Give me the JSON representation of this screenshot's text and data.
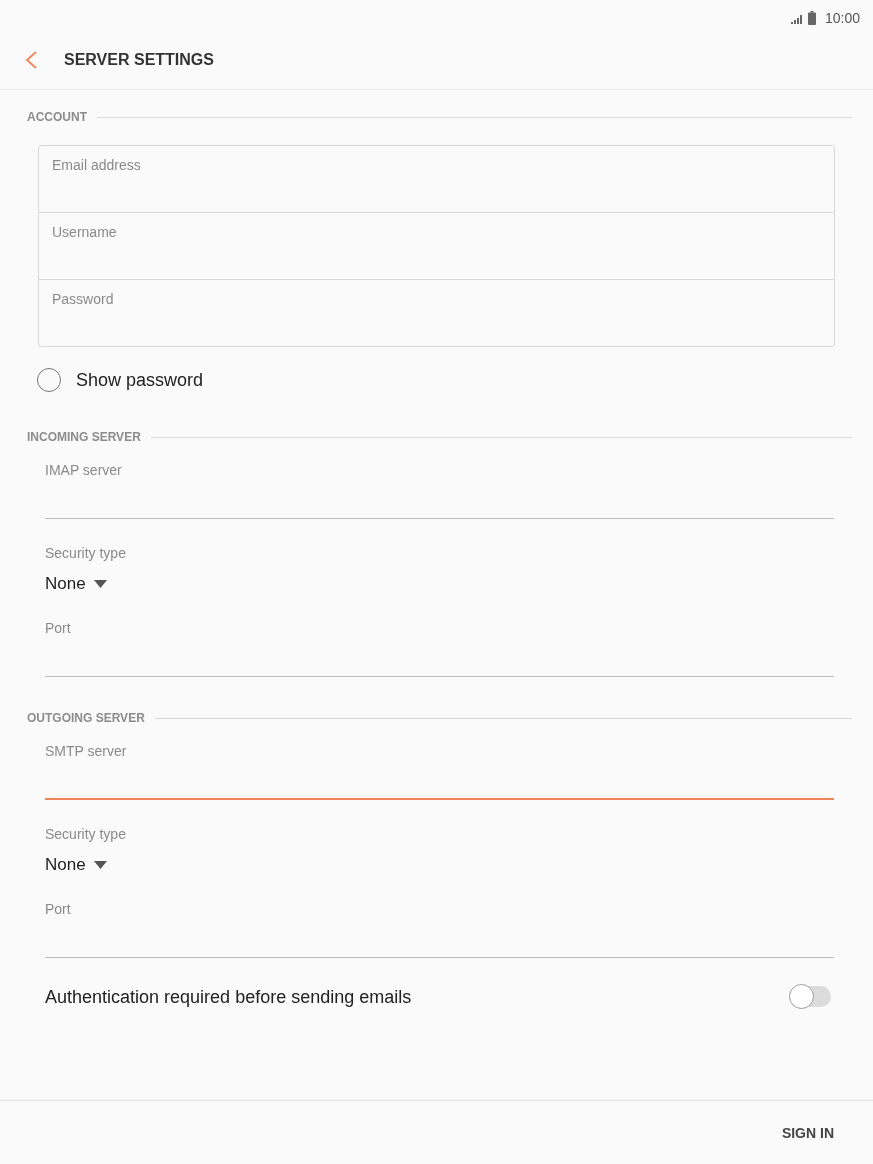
{
  "status_bar": {
    "time": "10:00"
  },
  "header": {
    "title": "SERVER SETTINGS"
  },
  "account": {
    "title": "ACCOUNT",
    "fields": [
      {
        "label": "Email address"
      },
      {
        "label": "Username"
      },
      {
        "label": "Password"
      }
    ],
    "show_password": {
      "label": "Show password",
      "checked": false
    }
  },
  "servers": [
    {
      "title": "INCOMING SERVER",
      "items": [
        {
          "kind": "text",
          "label": "IMAP server",
          "focused": false
        },
        {
          "kind": "select",
          "label": "Security type",
          "value": "None"
        },
        {
          "kind": "text",
          "label": "Port",
          "focused": false
        }
      ]
    },
    {
      "title": "OUTGOING SERVER",
      "items": [
        {
          "kind": "text",
          "label": "SMTP server",
          "focused": true
        },
        {
          "kind": "select",
          "label": "Security type",
          "value": "None"
        },
        {
          "kind": "text",
          "label": "Port",
          "focused": false
        }
      ]
    }
  ],
  "authentication": {
    "label": "Authentication required before sending emails",
    "on": false
  },
  "footer": {
    "button": "SIGN IN"
  }
}
